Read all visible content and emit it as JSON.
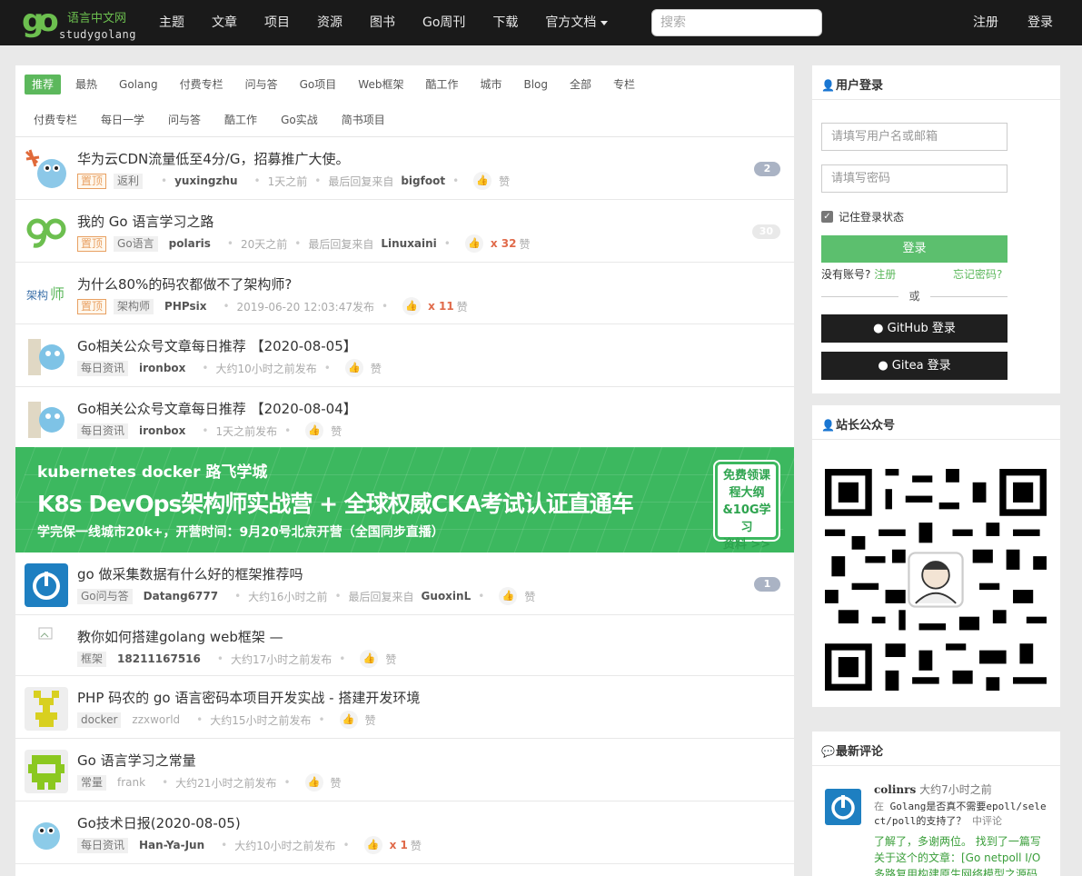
{
  "header": {
    "logo_cn": "语言中文网",
    "logo_en": "studygolang",
    "nav": [
      "主题",
      "文章",
      "项目",
      "资源",
      "图书",
      "Go周刊",
      "下载",
      "官方文档"
    ],
    "search_placeholder": "搜索",
    "register": "注册",
    "login": "登录"
  },
  "tabs_primary": [
    "推荐",
    "最热",
    "Golang",
    "付费专栏",
    "问与答",
    "Go项目",
    "Web框架",
    "酷工作",
    "城市",
    "Blog",
    "全部",
    "专栏"
  ],
  "tabs_secondary": [
    "付费专栏",
    "每日一学",
    "问与答",
    "酷工作",
    "Go实战",
    "简书项目"
  ],
  "items": [
    {
      "title": "华为云CDN流量低至4分/G，招募推广大使。",
      "top": "置顶",
      "tag": "返利",
      "author": "yuxingzhu",
      "time": "1天之前",
      "last_label": "最后回复来自",
      "last_user": "bigfoot",
      "likes": "",
      "like_label": "赞",
      "badge": "2"
    },
    {
      "title": "我的 Go 语言学习之路",
      "top": "置顶",
      "tag": "Go语言",
      "author": "polaris",
      "time": "20天之前",
      "last_label": "最后回复来自",
      "last_user": "Linuxaini",
      "likes": "x 32",
      "like_label": "赞",
      "badge": "30"
    },
    {
      "title": "为什么80%的码农都做不了架构师?",
      "top": "置顶",
      "tag": "架构师",
      "author": "PHPsix",
      "time": "2019-06-20 12:03:47发布",
      "last_label": "",
      "last_user": "",
      "likes": "x 11",
      "like_label": "赞",
      "badge": ""
    },
    {
      "title": "Go相关公众号文章每日推荐 【2020-08-05】",
      "top": "",
      "tag": "每日资讯",
      "author": "ironbox",
      "time": "大约10小时之前发布",
      "last_label": "",
      "last_user": "",
      "likes": "",
      "like_label": "赞",
      "badge": ""
    },
    {
      "title": "Go相关公众号文章每日推荐 【2020-08-04】",
      "top": "",
      "tag": "每日资讯",
      "author": "ironbox",
      "time": "1天之前发布",
      "last_label": "",
      "last_user": "",
      "likes": "",
      "like_label": "赞",
      "badge": ""
    }
  ],
  "banner": {
    "line1": "kubernetes   docker   路飞学城",
    "line2": "K8s DevOps架构师实战营 + 全球权威CKA考试认证直通车",
    "line3": "学完保一线城市20k+，开营时间：9月20号北京开营（全国同步直播）",
    "box": [
      "免费领课",
      "程大纲",
      "&10G学习",
      "资料 >>"
    ]
  },
  "items2": [
    {
      "title": "go 做采集数据有什么好的框架推荐吗",
      "tag": "Go问与答",
      "author": "Datang6777",
      "time": "大约16小时之前",
      "last_label": "最后回复来自",
      "last_user": "GuoxinL",
      "likes": "",
      "like_label": "赞",
      "badge": "1"
    },
    {
      "title": "教你如何搭建golang web框架 —",
      "tag": "框架",
      "author": "18211167516",
      "time": "大约17小时之前发布",
      "last_label": "",
      "last_user": "",
      "likes": "",
      "like_label": "赞",
      "badge": ""
    },
    {
      "title": "PHP 码农的 go 语言密码本项目开发实战 - 搭建开发环境",
      "tag": "docker",
      "author": "zzxworld",
      "time": "大约15小时之前发布",
      "last_label": "",
      "last_user": "",
      "likes": "",
      "like_label": "赞",
      "badge": ""
    },
    {
      "title": "Go 语言学习之常量",
      "tag": "常量",
      "author": "frank",
      "time": "大约21小时之前发布",
      "last_label": "",
      "last_user": "",
      "likes": "",
      "like_label": "赞",
      "badge": ""
    },
    {
      "title": "Go技术日报(2020-08-05)",
      "tag": "每日资讯",
      "author": "Han-Ya-Jun",
      "time": "大约10小时之前发布",
      "last_label": "",
      "last_user": "",
      "likes": "x 1",
      "like_label": "赞",
      "badge": ""
    }
  ],
  "login_panel": {
    "title": "用户登录",
    "username_placeholder": "请填写用户名或邮箱",
    "password_placeholder": "请填写密码",
    "remember": "记住登录状态",
    "login_button": "登录",
    "no_account": "没有账号?",
    "register_link": "注册",
    "forgot": "忘记密码?",
    "or": "或",
    "github": "GitHub 登录",
    "gitea": "Gitea 登录"
  },
  "wechat_panel": {
    "title": "站长公众号"
  },
  "comments_panel": {
    "title": "最新评论",
    "user": "colinrs",
    "time": "大约7小时之前",
    "topic_prefix": "在",
    "topic": "Golang是否真不需要epoll/select/poll的支持了？",
    "topic_suffix": "中评论",
    "content": "了解了，多谢两位。 找到了一篇写关于这个的文章：[Go netpoll I/O 多路复用构建原生网络模型之源码"
  },
  "colors": {
    "accent": "#5cb85c",
    "topbar": "#1a1a1a",
    "top_tag": "#e8a062",
    "badge": "#aab3c4"
  }
}
